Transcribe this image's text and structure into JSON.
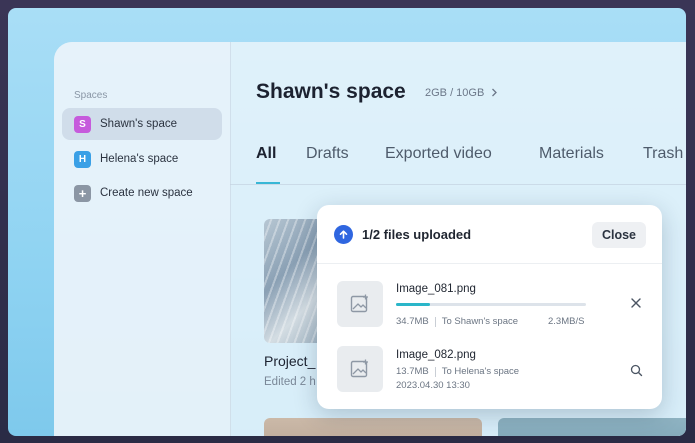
{
  "sidebar": {
    "heading": "Spaces",
    "items": [
      {
        "label": "Shawn's space",
        "badge": "S",
        "badge_color": "#c65bdc",
        "active": true
      },
      {
        "label": "Helena's space",
        "badge": "H",
        "badge_color": "#3aa0e6",
        "active": false
      },
      {
        "label": "Create new space",
        "badge": "+",
        "badge_color": "#8b96a4",
        "active": false
      }
    ]
  },
  "main": {
    "title": "Shawn's space",
    "storage": "2GB / 10GB",
    "tabs": [
      {
        "label": "All",
        "active": true
      },
      {
        "label": "Drafts"
      },
      {
        "label": "Exported video"
      },
      {
        "label": "Materials"
      },
      {
        "label": "Trash"
      }
    ],
    "project": {
      "title": "Project_",
      "subtitle": "Edited 2 h"
    }
  },
  "upload": {
    "title": "1/2 files uploaded",
    "close_label": "Close",
    "files": [
      {
        "name": "Image_081.png",
        "size": "34.7MB",
        "destination": "To Shawn's space",
        "speed": "2.3MB/S",
        "progress": 0.18,
        "action_icon": "close-icon"
      },
      {
        "name": "Image_082.png",
        "size": "13.7MB",
        "destination": "To Helena's space",
        "date": "2023.04.30 13:30",
        "action_icon": "search-icon"
      }
    ]
  },
  "colors": {
    "accent": "#2f66e0",
    "progress": "#2ab6c9",
    "tab_underline": "#38b7d6"
  }
}
